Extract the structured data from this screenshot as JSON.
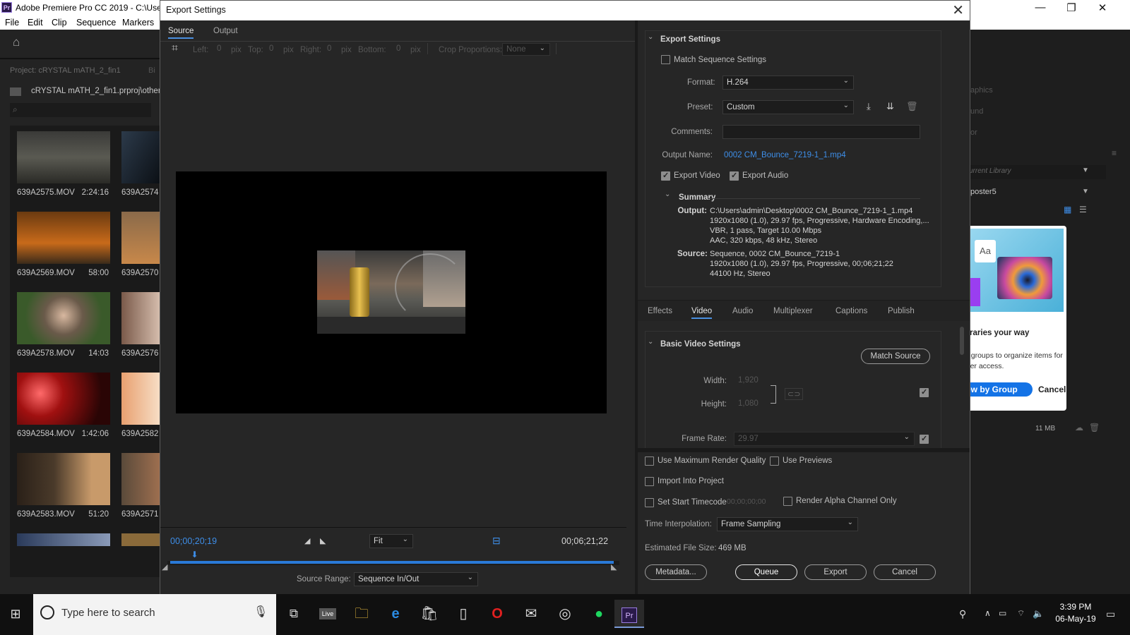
{
  "app": {
    "title": "Adobe Premiere Pro CC 2019 - C:\\User",
    "logo": "Pr",
    "menu": [
      "File",
      "Edit",
      "Clip",
      "Sequence",
      "Markers"
    ]
  },
  "project": {
    "label": "Project: cRYSTAL mATH_2_fin1",
    "tab_cut": "Bi",
    "path": "cRYSTAL mATH_2_fin1.prproj\\other",
    "clips": [
      {
        "name": "639A2575.MOV",
        "dur": "2:24:16"
      },
      {
        "name": "639A2574",
        "dur": ""
      },
      {
        "name": "639A2569.MOV",
        "dur": "58:00"
      },
      {
        "name": "639A2570",
        "dur": ""
      },
      {
        "name": "639A2578.MOV",
        "dur": "14:03"
      },
      {
        "name": "639A2576",
        "dur": ""
      },
      {
        "name": "639A2584.MOV",
        "dur": "1:42:06"
      },
      {
        "name": "639A2582",
        "dur": ""
      },
      {
        "name": "639A2583.MOV",
        "dur": "51:20"
      },
      {
        "name": "639A2571",
        "dur": ""
      }
    ]
  },
  "libraries": {
    "items": [
      "aphics",
      "und",
      "or"
    ],
    "library_select": "urrent Library",
    "poster": "poster5",
    "promo_title": "braries your way",
    "promo_text1": "n groups to organize items for",
    "promo_text2": "sier access.",
    "promo_btn": "ew by Group",
    "promo_cancel": "Cancel",
    "size": "11 MB"
  },
  "dialog": {
    "title": "Export Settings",
    "tabs": [
      "Source",
      "Output"
    ],
    "crop": {
      "left_lbl": "Left:",
      "left": "0",
      "top_lbl": "Top:",
      "top": "0",
      "right_lbl": "Right:",
      "right": "0",
      "bottom_lbl": "Bottom:",
      "bottom": "0",
      "unit": "pix",
      "proportions_lbl": "Crop Proportions:",
      "proportions": "None"
    },
    "timecode_in": "00;00;20;19",
    "timecode_out": "00;06;21;22",
    "fit": "Fit",
    "source_range_lbl": "Source Range:",
    "source_range": "Sequence In/Out",
    "playhead_fraction": 0.055,
    "export_settings": {
      "header": "Export Settings",
      "match_seq": "Match Sequence Settings",
      "format_lbl": "Format:",
      "format": "H.264",
      "preset_lbl": "Preset:",
      "preset": "Custom",
      "comments_lbl": "Comments:",
      "output_name_lbl": "Output Name:",
      "output_name": "0002 CM_Bounce_7219-1_1.mp4",
      "export_video": "Export Video",
      "export_audio": "Export Audio",
      "summary": "Summary",
      "output_lbl": "Output:",
      "output_lines": [
        "C:\\Users\\admin\\Desktop\\0002 CM_Bounce_7219-1_1.mp4",
        "1920x1080 (1.0), 29.97 fps, Progressive, Hardware Encoding,...",
        "VBR, 1 pass, Target 10.00 Mbps",
        "AAC, 320 kbps, 48 kHz, Stereo"
      ],
      "source_lbl": "Source:",
      "source_lines": [
        "Sequence, 0002 CM_Bounce_7219-1",
        "1920x1080 (1.0), 29.97 fps, Progressive, 00;06;21;22",
        "44100 Hz, Stereo"
      ]
    },
    "settings_tabs": [
      "Effects",
      "Video",
      "Audio",
      "Multiplexer",
      "Captions",
      "Publish"
    ],
    "video": {
      "header": "Basic Video Settings",
      "match_source": "Match Source",
      "width_lbl": "Width:",
      "width": "1,920",
      "height_lbl": "Height:",
      "height": "1,080",
      "frame_rate_lbl": "Frame Rate:",
      "frame_rate": "29.97"
    },
    "bottom": {
      "max_render": "Use Maximum Render Quality",
      "use_previews": "Use Previews",
      "import_project": "Import Into Project",
      "set_start_tc": "Set Start Timecode",
      "start_tc": "00;00;00;00",
      "render_alpha": "Render Alpha Channel Only",
      "time_interp_lbl": "Time Interpolation:",
      "time_interp": "Frame Sampling",
      "est_size_lbl": "Estimated File Size:",
      "est_size": "469 MB",
      "metadata": "Metadata...",
      "queue": "Queue",
      "export": "Export",
      "cancel": "Cancel"
    }
  },
  "taskbar": {
    "search_placeholder": "Type here to search",
    "time": "3:39 PM",
    "date": "06-May-19"
  }
}
